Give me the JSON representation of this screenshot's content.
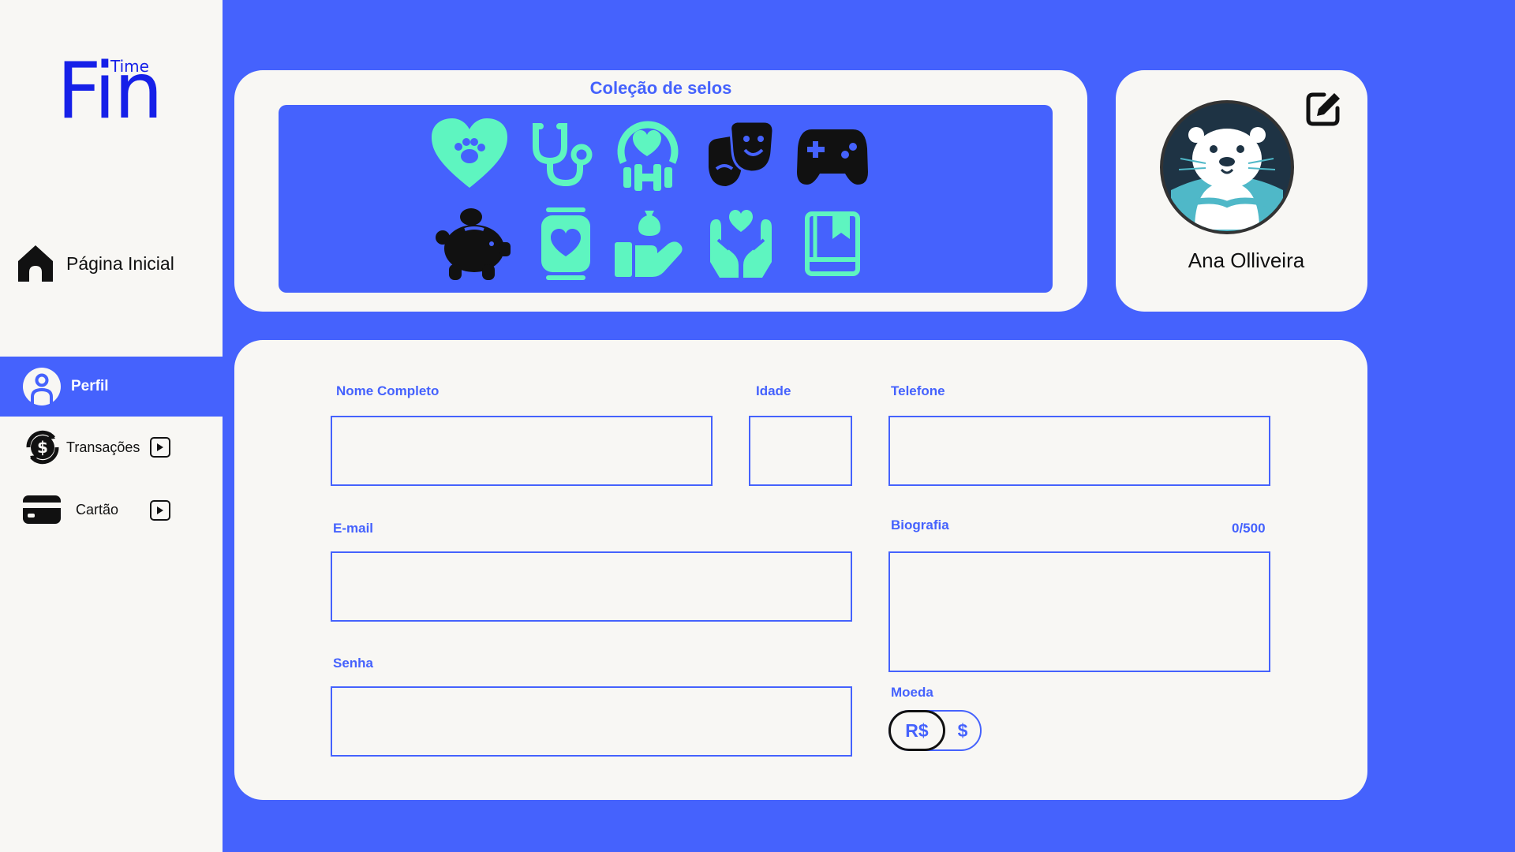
{
  "logo": {
    "main": "Fin",
    "super": "Time"
  },
  "sidebar": {
    "items": [
      {
        "label": "Página Inicial",
        "icon": "home-icon"
      },
      {
        "label": "Perfil",
        "icon": "user-icon",
        "active": true
      },
      {
        "label": "Transações",
        "icon": "dollar-cycle-icon"
      },
      {
        "label": "Cartão",
        "icon": "credit-card-icon"
      }
    ]
  },
  "stamps": {
    "title": "Coleção de selos",
    "icons": [
      "paw-heart-icon",
      "stethoscope-icon",
      "fitness-icon",
      "theater-masks-icon",
      "gamepad-icon",
      "piggy-bank-icon",
      "heart-jar-icon",
      "donation-hand-icon",
      "hands-heart-icon",
      "book-icon"
    ]
  },
  "profile": {
    "name": "Ana Olliveira"
  },
  "form": {
    "full_name_label": "Nome Completo",
    "age_label": "Idade",
    "phone_label": "Telefone",
    "email_label": "E-mail",
    "bio_label": "Biografia",
    "bio_counter": "0/500",
    "password_label": "Senha",
    "currency_label": "Moeda",
    "currency_options": [
      "R$",
      "$"
    ],
    "currency_selected": "R$"
  },
  "colors": {
    "accent": "#4562FD",
    "panel": "#F8F7F4",
    "mint": "#5EF5C0",
    "logo": "#1620E8"
  }
}
